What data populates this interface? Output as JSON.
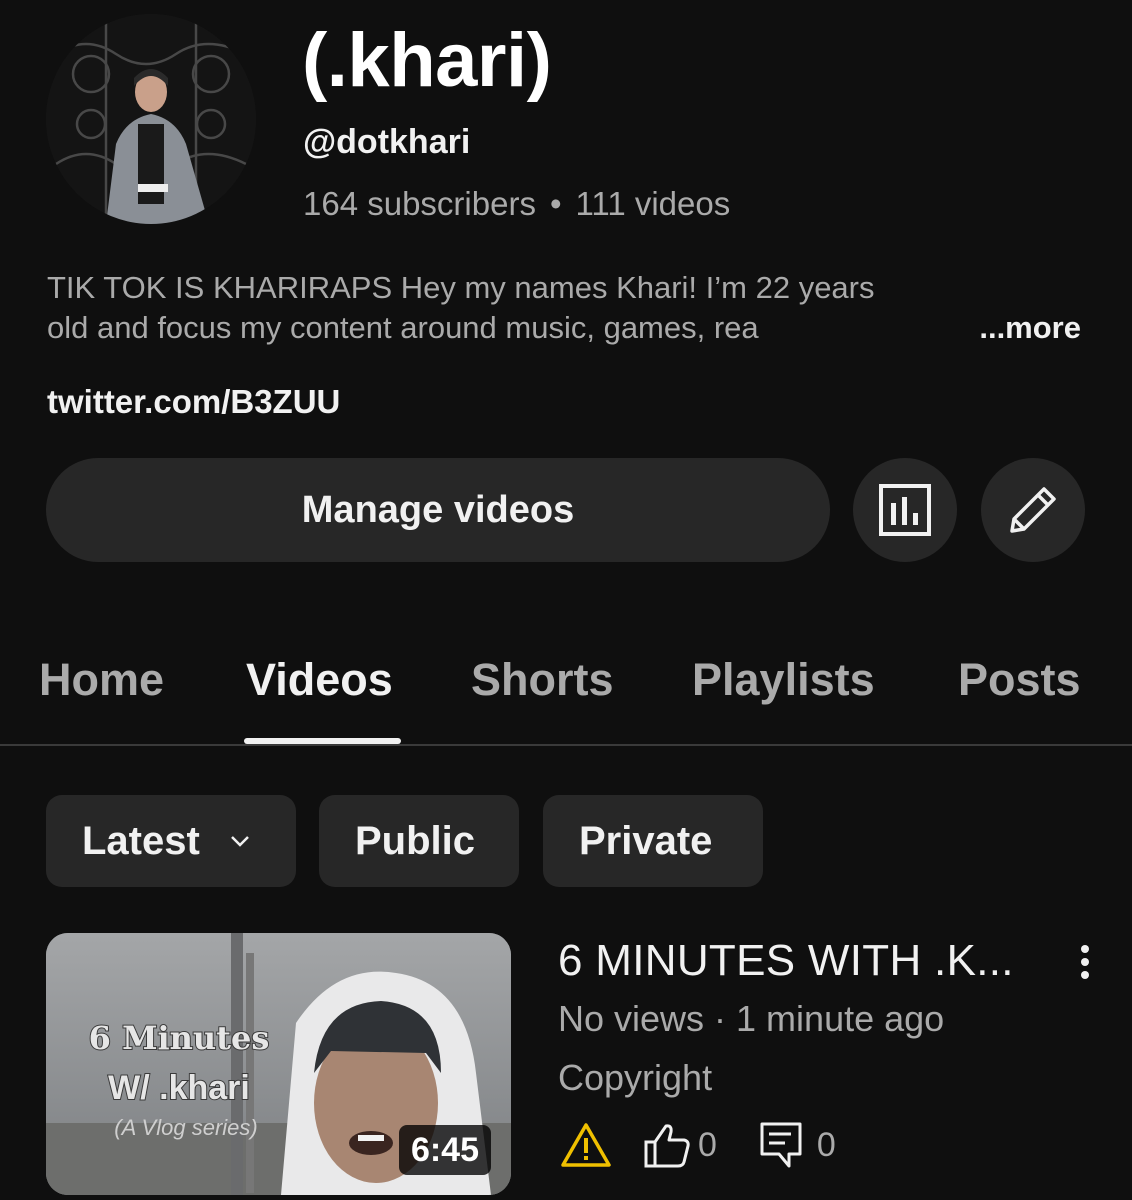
{
  "channel": {
    "name": "(.khari)",
    "handle": "@dotkhari",
    "subscribers": "164 subscribers",
    "separator": "•",
    "video_count": "111 videos",
    "description_line1": "TIK TOK IS KHARIRAPS Hey my names Khari! I’m 22 years",
    "description_line2": "old and focus my content around music, games, rea",
    "more_label": "...more",
    "link": "twitter.com/B3ZUU"
  },
  "actions": {
    "manage_label": "Manage videos",
    "stats_icon": "analytics-icon",
    "edit_icon": "pencil-icon"
  },
  "tabs": [
    {
      "label": "Home",
      "active": false
    },
    {
      "label": "Videos",
      "active": true
    },
    {
      "label": "Shorts",
      "active": false
    },
    {
      "label": "Playlists",
      "active": false
    },
    {
      "label": "Posts",
      "active": false
    }
  ],
  "filters": {
    "sort_label": "Latest",
    "public_label": "Public",
    "private_label": "Private"
  },
  "videos": [
    {
      "title": "6 MINUTES WITH .K...",
      "meta": "No views · 1 minute ago",
      "visibility": "Copyright",
      "duration": "6:45",
      "likes": "0",
      "comments": "0",
      "thumbnail_text_1": "6 Minutes",
      "thumbnail_text_2": "W/ .khari",
      "thumbnail_text_3": "(A Vlog series)"
    }
  ],
  "colors": {
    "background": "#0f0f0f",
    "surface": "#272727",
    "primary_text": "#f1f1f1",
    "secondary_text": "#aaaaaa",
    "warning": "#f0c000"
  }
}
